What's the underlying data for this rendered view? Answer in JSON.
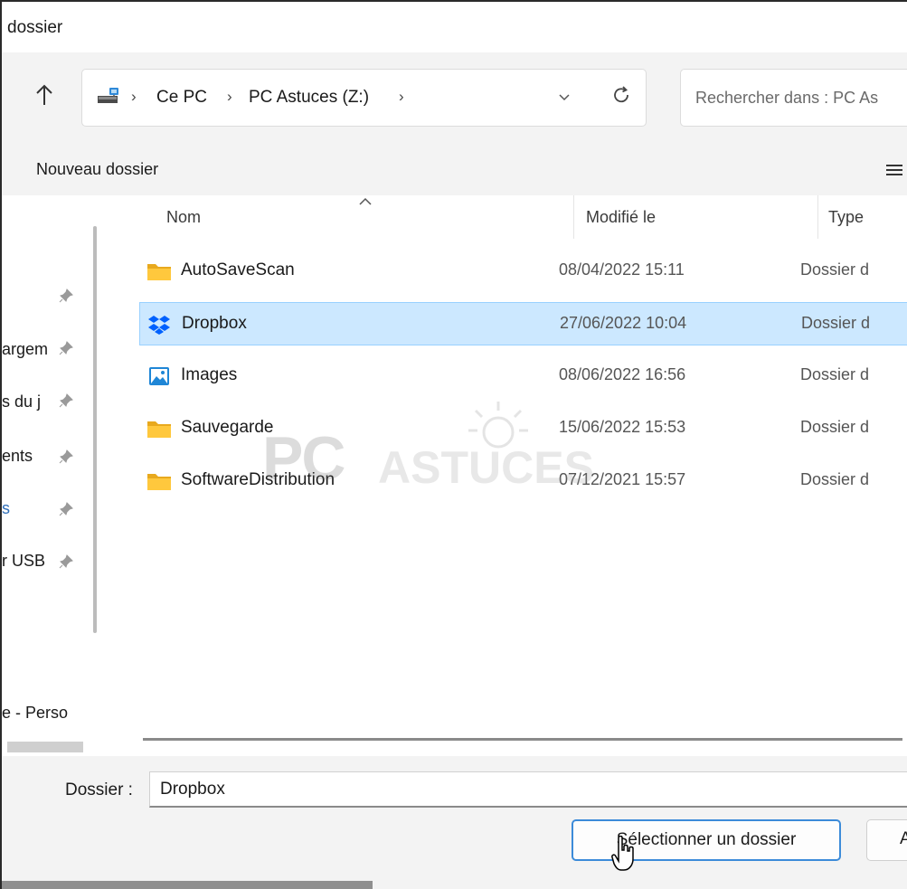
{
  "window": {
    "title": "dossier"
  },
  "navigation": {
    "breadcrumb": [
      "Ce PC",
      "PC Astuces (Z:)"
    ],
    "separator": "›",
    "search_placeholder": "Rechercher dans : PC As"
  },
  "toolbar": {
    "new_folder_label": "Nouveau dossier"
  },
  "sidebar": {
    "items": [
      {
        "label": "",
        "pinned": true
      },
      {
        "label": "argem",
        "pinned": true
      },
      {
        "label": "s du j",
        "pinned": true
      },
      {
        "label": "ents",
        "pinned": true
      },
      {
        "label": "s",
        "pinned": true
      },
      {
        "label": "r USB",
        "pinned": true
      },
      {
        "label": "e - Perso",
        "pinned": false
      }
    ]
  },
  "file_list": {
    "columns": [
      "Nom",
      "Modifié le",
      "Type"
    ],
    "rows": [
      {
        "name": "AutoSaveScan",
        "modified": "08/04/2022 15:11",
        "type": "Dossier d",
        "icon": "folder-icon",
        "selected": false
      },
      {
        "name": "Dropbox",
        "modified": "27/06/2022 10:04",
        "type": "Dossier d",
        "icon": "dropbox-icon",
        "selected": true
      },
      {
        "name": "Images",
        "modified": "08/06/2022 16:56",
        "type": "Dossier d",
        "icon": "images-folder-icon",
        "selected": false
      },
      {
        "name": "Sauvegarde",
        "modified": "15/06/2022 15:53",
        "type": "Dossier d",
        "icon": "folder-icon",
        "selected": false
      },
      {
        "name": "SoftwareDistribution",
        "modified": "07/12/2021 15:57",
        "type": "Dossier d",
        "icon": "folder-icon",
        "selected": false
      }
    ]
  },
  "watermark": {
    "brand": "PC",
    "suffix": "ASTUCES"
  },
  "footer": {
    "folder_label": "Dossier :",
    "folder_value": "Dropbox",
    "select_button": "Sélectionner un dossier",
    "secondary_button": "A"
  },
  "colors": {
    "selection_bg": "#cce8ff",
    "selection_border": "#99d1ff",
    "primary_button_border": "#3c8bd9",
    "folder_yellow": "#ffc83d",
    "dropbox_blue": "#0061fe"
  }
}
